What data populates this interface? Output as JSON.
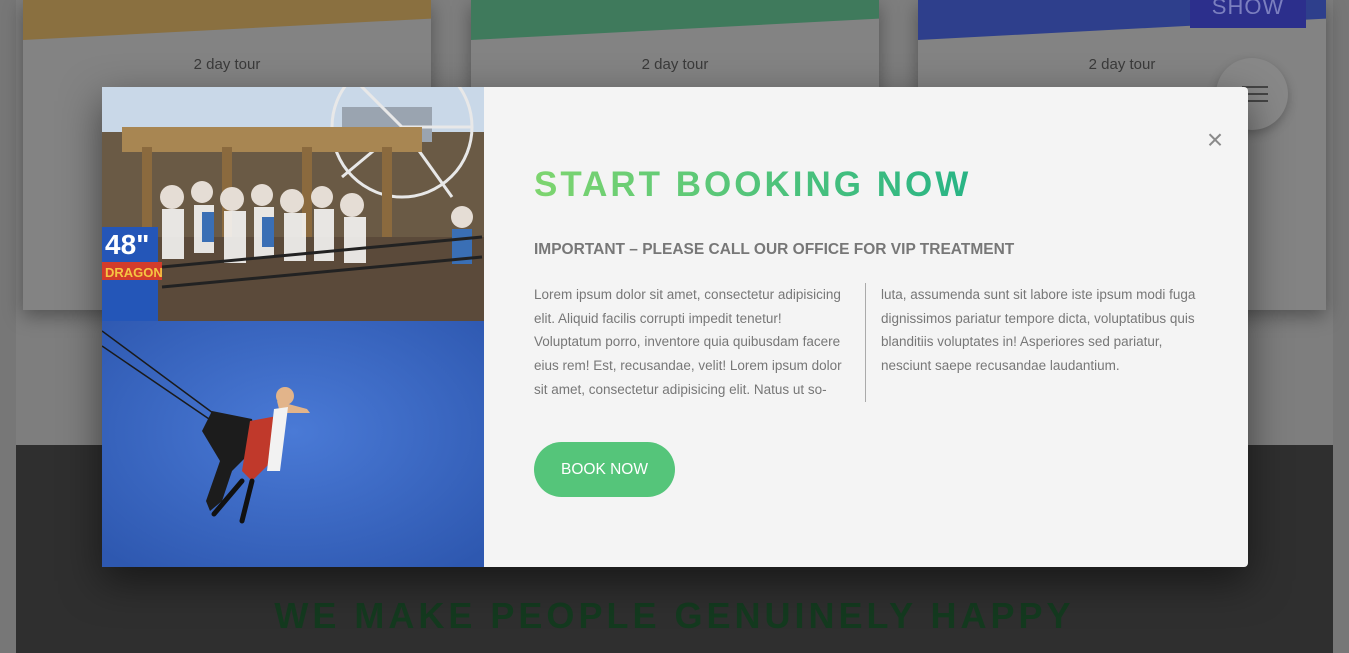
{
  "background": {
    "cards": [
      {
        "tour": "2 day tour"
      },
      {
        "tour": "2 day tour"
      },
      {
        "tour": "2 day tour",
        "tag": "SHOW"
      }
    ],
    "section_heading": "WE MAKE PEOPLE GENUINELY HAPPY",
    "menu_icon": "hamburger-icon"
  },
  "modal": {
    "close_icon": "×",
    "title": "START BOOKING NOW",
    "subtitle": "IMPORTANT – PLEASE CALL OUR OFFICE FOR VIP TREATMENT",
    "text_col_1": "Lorem ipsum dolor sit amet, consectetur adipisicing elit. Aliquid facilis corrupti impedit tenetur! Voluptatum porro, inventore quia quibusdam facere eius rem! Est, recusandae, velit! Lorem ipsum dolor sit amet, consectetur adipisicing elit. Natus ut so-",
    "text_col_2": "luta, assumenda sunt sit labore iste ipsum modi fuga dignissimos pariatur tempore dicta, voluptatibus quis blanditiis voluptates in! Asperiores sed pariatur, nesciunt saepe recusandae laudantium.",
    "book_button": "BOOK NOW",
    "images": [
      {
        "sign_text_1": "48\"",
        "sign_text_2": "DRAGON"
      },
      {}
    ]
  },
  "colors": {
    "accent_start": "#7ed56f",
    "accent_end": "#28b485",
    "button": "#55c57a"
  }
}
